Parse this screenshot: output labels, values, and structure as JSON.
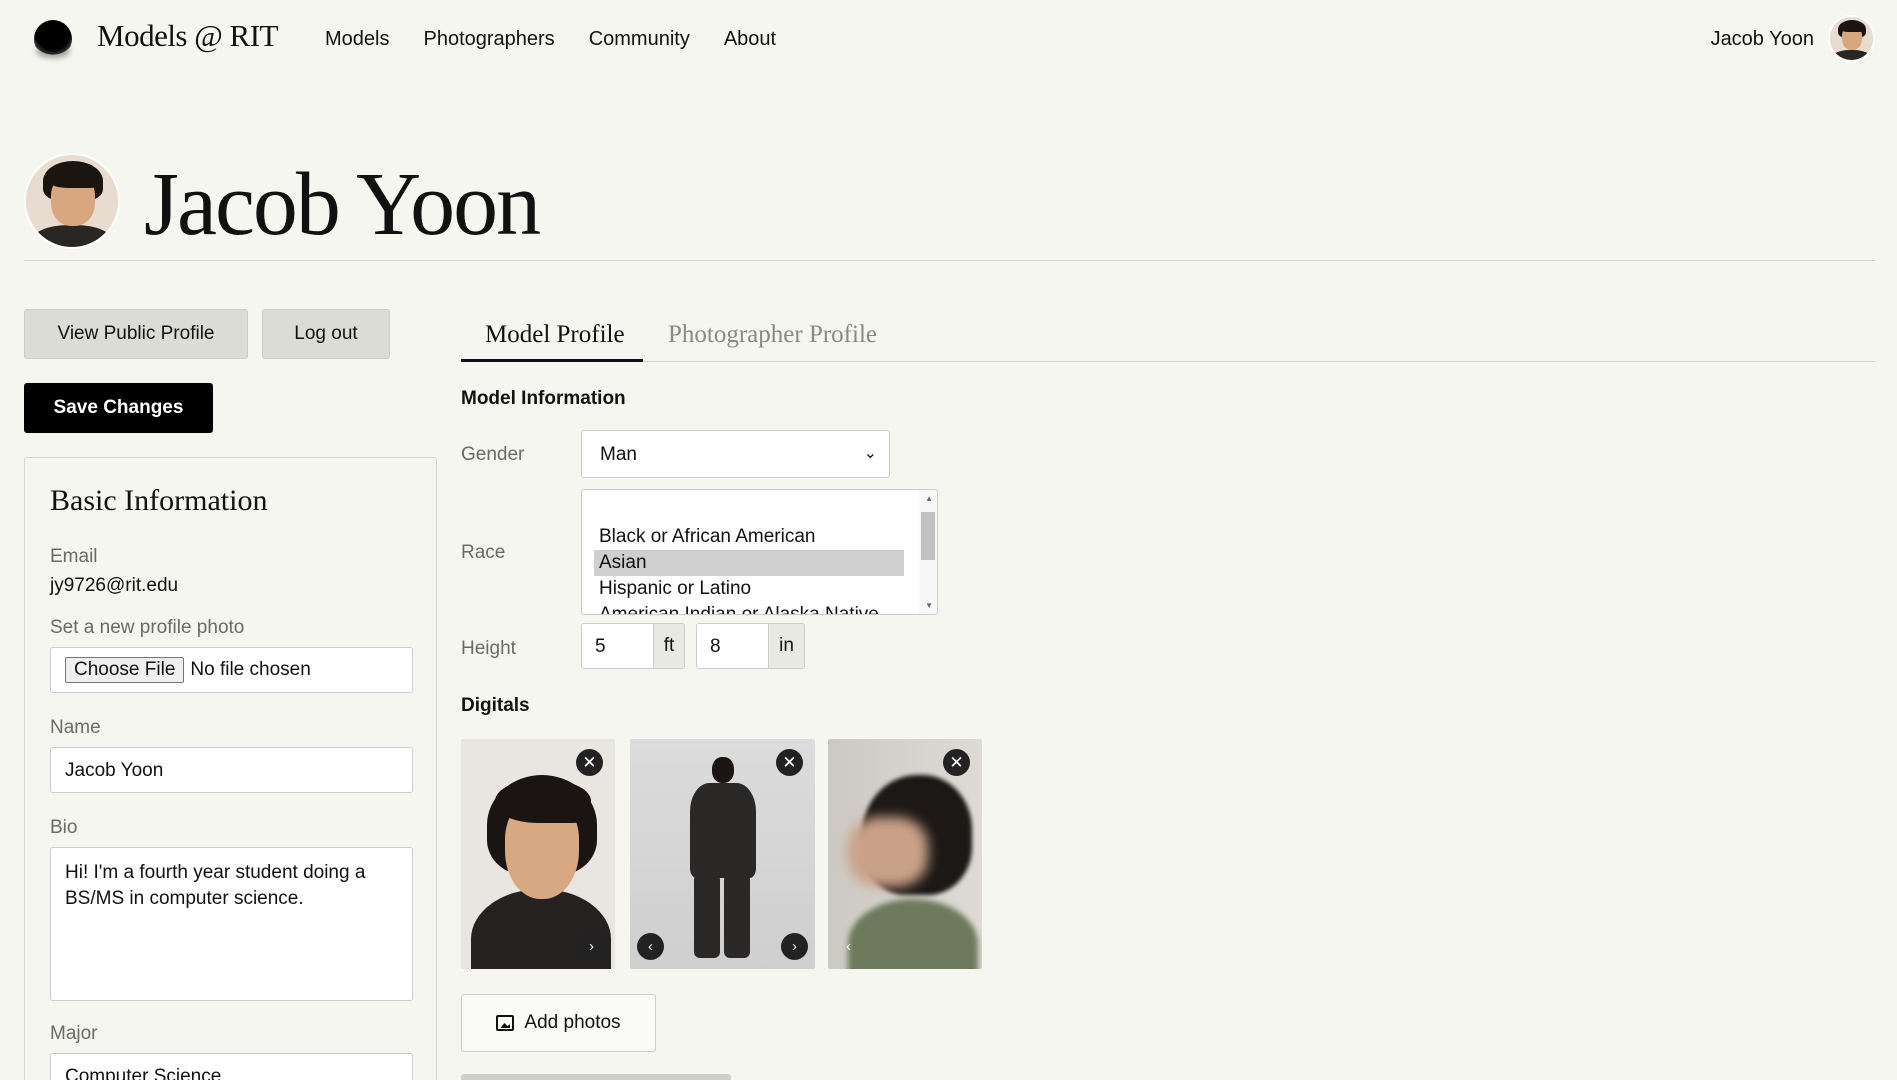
{
  "nav": {
    "brand": "Models @ RIT",
    "links": [
      "Models",
      "Photographers",
      "Community",
      "About"
    ],
    "user_name": "Jacob Yoon"
  },
  "profile": {
    "name": "Jacob Yoon"
  },
  "actions": {
    "view_public": "View Public Profile",
    "logout": "Log out",
    "save": "Save Changes"
  },
  "basic": {
    "title": "Basic Information",
    "email_label": "Email",
    "email_value": "jy9726@rit.edu",
    "photo_label": "Set a new profile photo",
    "file_button": "Choose File",
    "file_status": "No file chosen",
    "name_label": "Name",
    "name_value": "Jacob Yoon",
    "bio_label": "Bio",
    "bio_value": "Hi! I'm a fourth year student doing a BS/MS in computer science.",
    "major_label": "Major",
    "major_value": "Computer Science"
  },
  "tabs": [
    "Model Profile",
    "Photographer Profile"
  ],
  "model": {
    "section_title": "Model Information",
    "gender_label": "Gender",
    "gender_value": "Man",
    "race_label": "Race",
    "race_options": [
      "Black or African American",
      "Asian",
      "Hispanic or Latino",
      "American Indian or Alaska Native"
    ],
    "race_selected": "Asian",
    "height_label": "Height",
    "height_ft": "5",
    "height_ft_unit": "ft",
    "height_in": "8",
    "height_in_unit": "in",
    "digitals_title": "Digitals",
    "add_photos": "Add photos"
  }
}
